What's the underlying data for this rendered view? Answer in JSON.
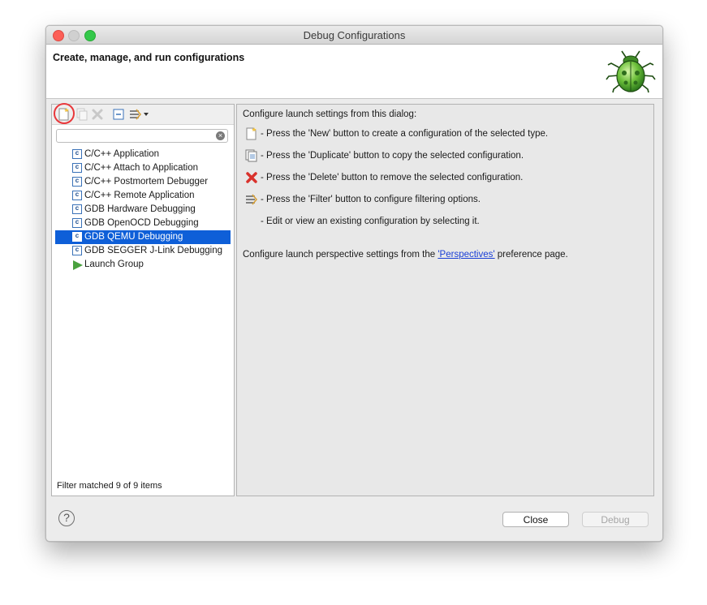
{
  "window": {
    "title": "Debug Configurations"
  },
  "banner": {
    "title": "Create, manage, and run configurations"
  },
  "toolbar": {
    "icons": [
      "new-configuration-icon",
      "duplicate-icon",
      "delete-icon",
      "collapse-all-icon",
      "filter-icon",
      "dropdown-arrow-icon"
    ],
    "highlight_color": "#e8383b"
  },
  "filter": {
    "value": "",
    "placeholder": ""
  },
  "tree": {
    "items": [
      {
        "label": "C/C++ Application",
        "icon": "c-config-icon",
        "selected": false
      },
      {
        "label": "C/C++ Attach to Application",
        "icon": "c-config-icon",
        "selected": false
      },
      {
        "label": "C/C++ Postmortem Debugger",
        "icon": "c-config-icon",
        "selected": false
      },
      {
        "label": "C/C++ Remote Application",
        "icon": "c-config-icon",
        "selected": false
      },
      {
        "label": "GDB Hardware Debugging",
        "icon": "c-config-icon",
        "selected": false
      },
      {
        "label": "GDB OpenOCD Debugging",
        "icon": "c-config-icon",
        "selected": false
      },
      {
        "label": "GDB QEMU Debugging",
        "icon": "c-config-icon",
        "selected": true
      },
      {
        "label": "GDB SEGGER J-Link Debugging",
        "icon": "c-config-icon",
        "selected": false
      },
      {
        "label": "Launch Group",
        "icon": "launch-group-icon",
        "selected": false
      }
    ],
    "selection_color": "#0e5fd8"
  },
  "status": {
    "text": "Filter matched 9 of 9 items"
  },
  "info": {
    "heading": "Configure launch settings from this dialog:",
    "lines": [
      {
        "icon": "new-icon",
        "text": "- Press the 'New' button to create a configuration of the selected type."
      },
      {
        "icon": "duplicate-icon",
        "text": "- Press the 'Duplicate' button to copy the selected configuration."
      },
      {
        "icon": "delete-icon",
        "text": "- Press the 'Delete' button to remove the selected configuration."
      },
      {
        "icon": "filter-icon",
        "text": "- Press the 'Filter' button to configure filtering options."
      },
      {
        "icon": "",
        "text": "- Edit or view an existing configuration by selecting it."
      }
    ],
    "perspective_prefix": "Configure launch perspective settings from the ",
    "perspective_link": "'Perspectives'",
    "perspective_suffix": " preference page."
  },
  "buttons": {
    "close": "Close",
    "debug": "Debug"
  },
  "colors": {
    "link": "#1a3fd6",
    "delete": "#d9322c",
    "bug": "#6cbf3a"
  }
}
